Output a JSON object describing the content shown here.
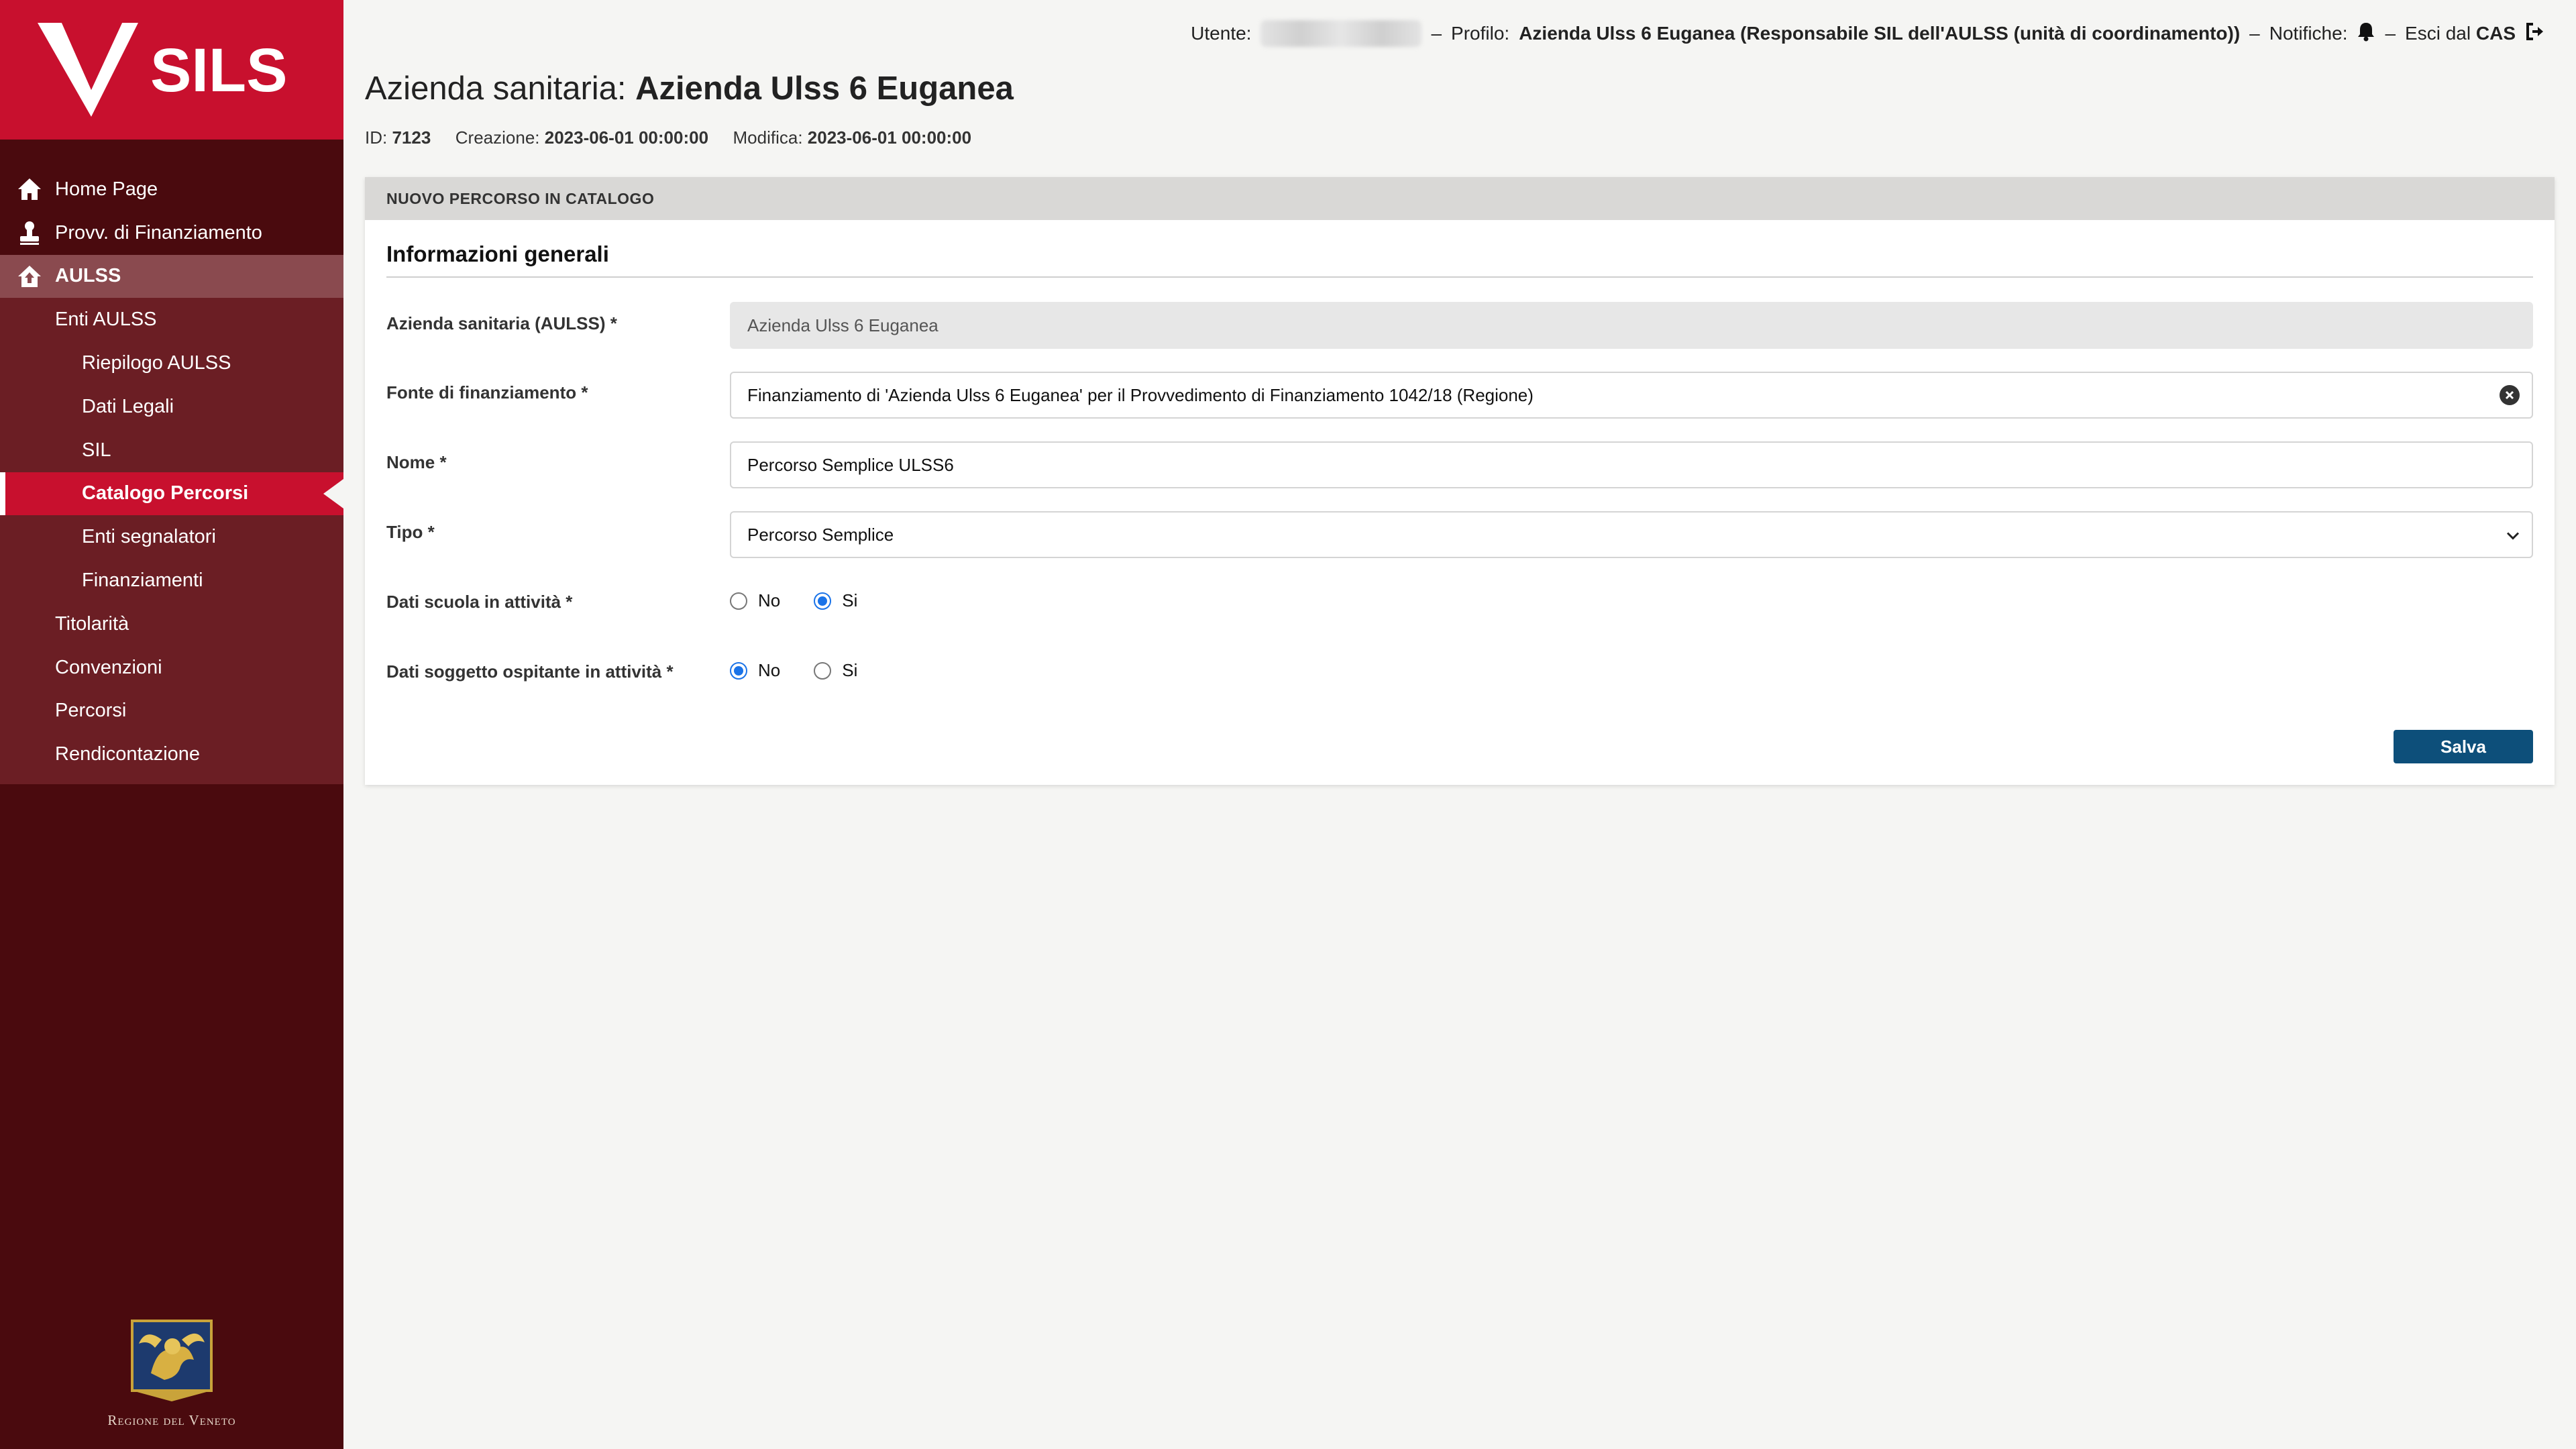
{
  "brand": {
    "name": "SILS",
    "primary_color": "#c8102e",
    "sidebar_color": "#4a0a0e"
  },
  "sidebar": {
    "items": [
      {
        "label": "Home Page",
        "icon": "home-icon"
      },
      {
        "label": "Provv. di Finanziamento",
        "icon": "stamp-icon"
      }
    ],
    "section": {
      "label": "AULSS",
      "icon": "house-up-icon"
    },
    "subitems": [
      {
        "label": "Enti AULSS",
        "level": 1
      },
      {
        "label": "Riepilogo AULSS",
        "level": 2
      },
      {
        "label": "Dati Legali",
        "level": 2
      },
      {
        "label": "SIL",
        "level": 2
      },
      {
        "label": "Catalogo Percorsi",
        "level": 2,
        "active": true
      },
      {
        "label": "Enti segnalatori",
        "level": 2
      },
      {
        "label": "Finanziamenti",
        "level": 2
      },
      {
        "label": "Titolarità",
        "level": 1
      },
      {
        "label": "Convenzioni",
        "level": 1
      },
      {
        "label": "Percorsi",
        "level": 1
      },
      {
        "label": "Rendicontazione",
        "level": 1
      }
    ],
    "footer": {
      "label": "Regione del Veneto"
    }
  },
  "topbar": {
    "user_label": "Utente:",
    "profile_label": "Profilo:",
    "profile_value": "Azienda Ulss 6 Euganea (Responsabile SIL dell'AULSS (unità di coordinamento))",
    "notifications_label": "Notifiche:",
    "logout_label": "Esci dal",
    "logout_value": "CAS",
    "separator": "–"
  },
  "header": {
    "title_prefix": "Azienda sanitaria:",
    "title_value": "Azienda Ulss 6 Euganea",
    "id_label": "ID:",
    "id_value": "7123",
    "created_label": "Creazione:",
    "created_value": "2023-06-01 00:00:00",
    "modified_label": "Modifica:",
    "modified_value": "2023-06-01 00:00:00"
  },
  "card": {
    "heading": "NUOVO PERCORSO IN CATALOGO",
    "section_title": "Informazioni generali",
    "fields": {
      "azienda": {
        "label": "Azienda sanitaria (AULSS) *",
        "value": "Azienda Ulss 6 Euganea"
      },
      "fonte": {
        "label": "Fonte di finanziamento *",
        "value": "Finanziamento di 'Azienda Ulss 6 Euganea' per il Provvedimento di Finanziamento 1042/18 (Regione)"
      },
      "nome": {
        "label": "Nome *",
        "value": "Percorso Semplice ULSS6"
      },
      "tipo": {
        "label": "Tipo *",
        "value": "Percorso Semplice"
      },
      "scuola": {
        "label": "Dati scuola in attività *",
        "options": [
          "No",
          "Si"
        ],
        "selected": "Si"
      },
      "ospitante": {
        "label": "Dati soggetto ospitante in attività *",
        "options": [
          "No",
          "Si"
        ],
        "selected": "No"
      }
    },
    "save_label": "Salva"
  }
}
